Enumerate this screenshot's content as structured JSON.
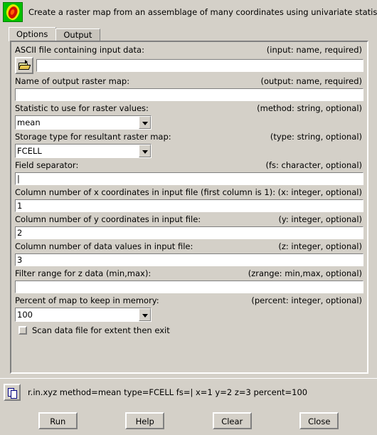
{
  "window": {
    "title": "Create a raster map from an assemblage of many coordinates using univariate statistics.",
    "icon": "raster-map-icon"
  },
  "tabs": [
    {
      "label": "Options",
      "active": true
    },
    {
      "label": "Output",
      "active": false
    }
  ],
  "fields": {
    "input": {
      "label": "ASCII file containing input data:",
      "hint": "(input:  name, required)",
      "value": "",
      "browse_icon": "open-folder-icon"
    },
    "output": {
      "label": "Name of output raster map:",
      "hint": "(output:  name, required)",
      "value": ""
    },
    "method": {
      "label": "Statistic to use for raster values:",
      "hint": "(method:  string, optional)",
      "value": "mean"
    },
    "type": {
      "label": "Storage type for resultant raster map:",
      "hint": "(type:  string, optional)",
      "value": "FCELL"
    },
    "fs": {
      "label": "Field separator:",
      "hint": "(fs:  character, optional)",
      "value": "|"
    },
    "x": {
      "label": "Column number of x coordinates in input file (first column is 1):",
      "hint": "(x:  integer, optional)",
      "value": "1"
    },
    "y": {
      "label": "Column number of y coordinates in input file:",
      "hint": "(y:  integer, optional)",
      "value": "2"
    },
    "z": {
      "label": "Column number of data values in input file:",
      "hint": "(z:  integer, optional)",
      "value": "3"
    },
    "zrange": {
      "label": "Filter range for z data (min,max):",
      "hint": "(zrange:  min,max, optional)",
      "value": ""
    },
    "percent": {
      "label": "Percent of map to keep in memory:",
      "hint": "(percent:  integer, optional)",
      "value": "100"
    },
    "scan": {
      "label": "Scan data file for extent then exit",
      "checked": false
    }
  },
  "command_bar": {
    "copy_icon": "copy-icon",
    "command": "r.in.xyz method=mean type=FCELL fs=| x=1 y=2 z=3 percent=100"
  },
  "buttons": [
    {
      "label": "Run"
    },
    {
      "label": "Help"
    },
    {
      "label": "Clear"
    },
    {
      "label": "Close"
    }
  ],
  "colors": {
    "face": "#d4d0c8",
    "shadow": "#808080",
    "light": "#ffffff",
    "field": "#ffffff"
  }
}
